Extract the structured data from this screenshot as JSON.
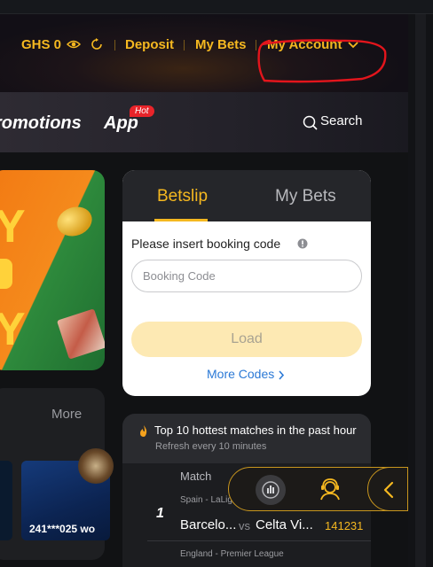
{
  "header": {
    "balance": "GHS 0",
    "deposit_label": "Deposit",
    "mybets_label": "My Bets",
    "account_label": "My Account",
    "icons": [
      "eye-icon",
      "refresh-icon",
      "chevron-down-icon"
    ],
    "accent_color": "#f5b820"
  },
  "nav": {
    "promotions_label": "romotions",
    "app_label": "App",
    "hot_badge": "Hot",
    "search_label": "Search",
    "hot_badge_color": "#e8242a"
  },
  "banner": {
    "letters": [
      "Y",
      "Y"
    ]
  },
  "more_panel": {
    "more_label": "More",
    "tile_caption": "241***025 wo"
  },
  "betslip": {
    "tabs": [
      {
        "label": "Betslip",
        "active": true
      },
      {
        "label": "My Bets",
        "active": false
      }
    ],
    "prompt": "Please insert booking code",
    "input_placeholder": "Booking Code",
    "input_value": "",
    "load_label": "Load",
    "more_codes_label": "More Codes",
    "link_color": "#2b79d6"
  },
  "hottest": {
    "title": "Top 10 hottest matches in the past hour",
    "subtitle": "Refresh every 10 minutes",
    "column_match": "Match",
    "rows": [
      {
        "rank": "1",
        "league": "Spain - LaLiga",
        "home": "Barcelo...",
        "vs": "vs",
        "away": "Celta Vi...",
        "code": "141231"
      },
      {
        "league": "England - Premier League"
      }
    ]
  },
  "floatbar": {
    "icons": [
      "stats-icon",
      "support-agent-icon",
      "chevron-left-icon"
    ]
  }
}
